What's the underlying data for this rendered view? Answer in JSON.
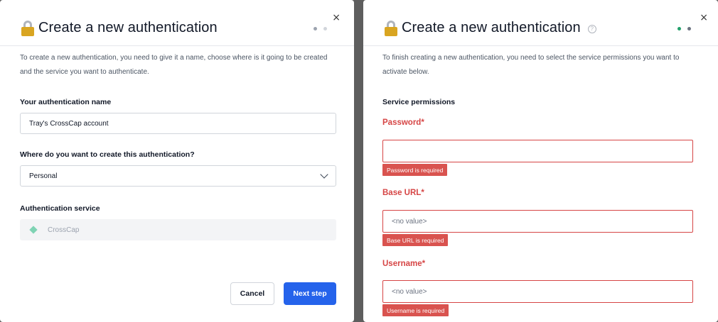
{
  "background_text": "",
  "left": {
    "title": "Create a new authentication",
    "close": "×",
    "description": "To create a new authentication, you need to give it a name, choose where is it going to be created and the service you want to authenticate.",
    "name_label": "Your authentication name",
    "name_value": "Tray's CrossCap account",
    "location_label": "Where do you want to create this authentication?",
    "location_value": "Personal",
    "service_label": "Authentication service",
    "service_value": "CrossCap",
    "cancel_label": "Cancel",
    "next_label": "Next step"
  },
  "right": {
    "title": "Create a new authentication",
    "help": "?",
    "close": "×",
    "description": "To finish creating a new authentication, you need to select the service permissions you want to activate below.",
    "section_label": "Service permissions",
    "fields": [
      {
        "label": "Password*",
        "value": "",
        "error": "Password is required"
      },
      {
        "label": "Base URL*",
        "value": "<no value>",
        "error": "Base URL is required"
      },
      {
        "label": "Username*",
        "value": "<no value>",
        "error": "Username is required"
      }
    ]
  },
  "colors": {
    "primary": "#2563eb",
    "error": "#d64545",
    "step_active_green": "#22a06b"
  }
}
